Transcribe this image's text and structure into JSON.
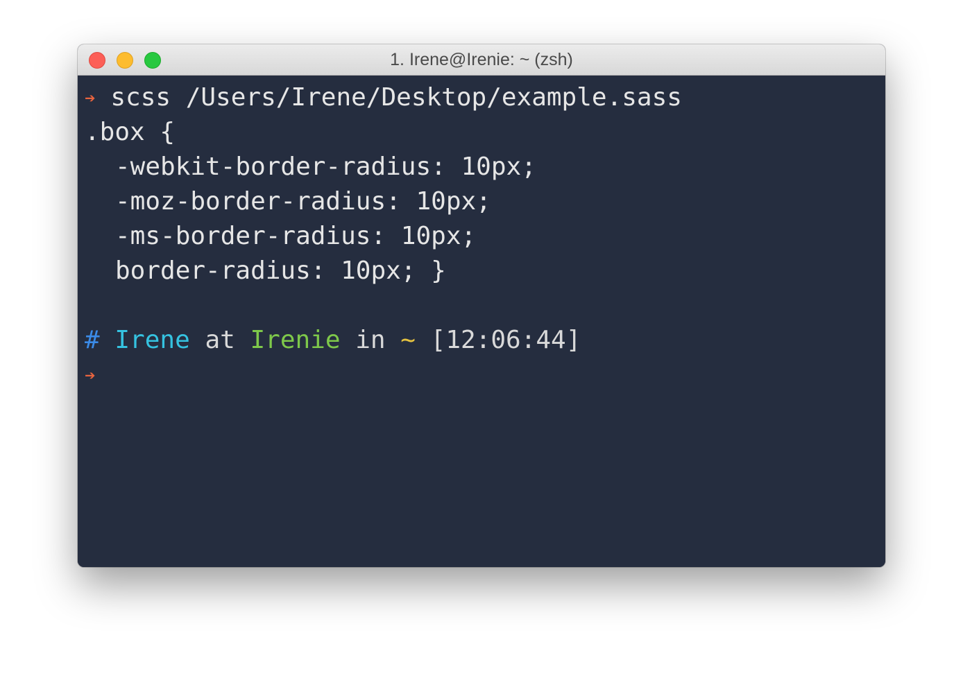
{
  "window": {
    "title": "1. Irene@Irenie: ~ (zsh)",
    "colors": {
      "background": "#252d3f",
      "close": "#fc5f57",
      "minimize": "#fdbc2e",
      "zoom": "#28c840"
    }
  },
  "terminal": {
    "prompt_arrow": "➔",
    "command": "scss /Users/Irene/Desktop/example.sass",
    "output": [
      ".box {",
      "-webkit-border-radius: 10px;",
      "-moz-border-radius: 10px;",
      "-ms-border-radius: 10px;",
      "border-radius: 10px; }"
    ],
    "status": {
      "hash": "#",
      "user": "Irene",
      "at": "at",
      "host": "Irenie",
      "in": "in",
      "path": "~",
      "time": "[12:06:44]"
    },
    "colors": {
      "arrow": "#e8643f",
      "hash": "#3b8be8",
      "user": "#35c2e0",
      "host": "#7ec84a",
      "path": "#e5c240",
      "text": "#e6e6e6"
    }
  }
}
